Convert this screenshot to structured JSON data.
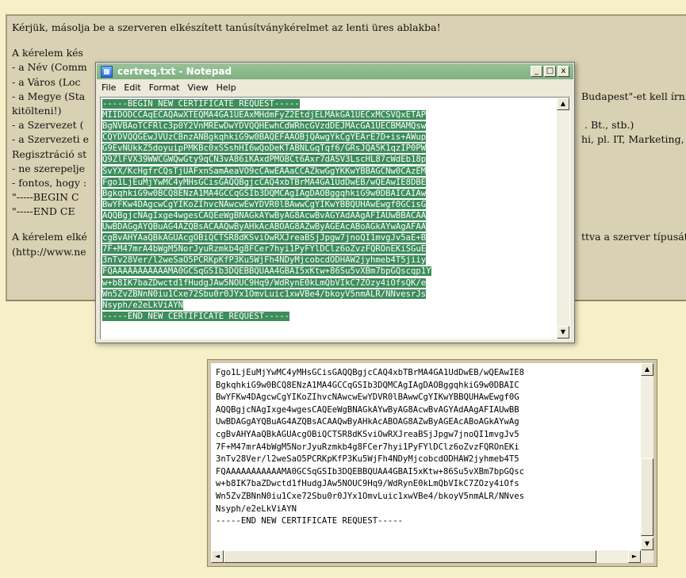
{
  "instructions": {
    "intro": "Kérjük, másolja be a szerveren elkészített tanúsítványkérelmet az lenti üres ablakba!",
    "lines": [
      "A kérelem kés",
      "- a Név (Comm",
      "- a Város (Loc",
      "- a Megye (Sta",
      "kitölteni!)",
      "- a Szervezet (",
      "- a Szervezeti e",
      "Regisztráció st",
      "- ne szerepelje",
      "- fontos, hogy :",
      "\"-----BEGIN C",
      "\"-----END CE"
    ],
    "right_fragments": [
      "",
      "",
      "",
      "Budapest\"-et kell írni!",
      "",
      ". Bt., stb.)",
      "hi, pl. IT, Marketing, H",
      "",
      "",
      "",
      "",
      ""
    ],
    "footer_lines": [
      "A kérelem elké",
      "(http://www.ne"
    ],
    "footer_right": [
      "ttva a szerver típusát",
      ""
    ]
  },
  "notepad": {
    "title": "certreq.txt - Notepad",
    "controls": {
      "minimize": "_",
      "maximize": "□",
      "close": "x"
    },
    "menu": [
      "File",
      "Edit",
      "Format",
      "View",
      "Help"
    ],
    "lines": [
      "-----BEGIN NEW CERTIFICATE REQUEST-----",
      "MIIDODCCAqECAQAwXTEQMA4GA1UEAxMHdmFyZ2EtdjELMAkGA1UECxMCSVQxETAP",
      "BgNVBAoTCFRlc3p0Y2VnMREwDwYDVQQHEwhCdWRhcGVzdDEJMAcGA1UECBMAMQsw",
      "CQYDVQQGEwJVUzCBnzANBgkqhkiG9w0BAQEFAAOBjQAwgYkCgYEArE7D+is+AWup",
      "G9EvNUkkZ5doyuipPMKBc0xSSshHI6wQoDeKTABNLGqTqf6/GRsJQA5K1qzIP0PW",
      "Q9ZlFVX39WWCGWQwGty9qCN3vA86iKAxdPMOBCt6Axr7dASV3LscHL87cWdEb18p",
      "SvYX/KcHgfrCQsTjUAFxnSamAeaVO9cCAwEAAaCCAZkwGgYKKwYBBAGCNw0CAzEM",
      "Fgo1LjEuMjYwMC4yMHsGCisGAQQBgjcCAQ4xbTBrMA4GA1UdDwEB/wQEAwIE8DBE",
      "BgkqhkiG9w0BCQ8ENzA1MA4GCCqGSIb3DQMCAgIAgDAOBggqhkiG9w0DBAICAIAw",
      "BwYFKw4DAgcwCgYIKoZIhvcNAwcwEwYDVR0lBAwwCgYIKwYBBQUHAwEwgf0GCisG",
      "AQQBgjcNAgIxge4wgesCAQEeWgBNAGkAYwByAG8AcwBvAGYAdAAgAFIAUwBBACAA",
      "UwBDAGgAYQBuAG4AZQBsACAAQwByAHkAcABOAG8AZwByAGEAcABoAGkAYwAgAFAA",
      "cgBvAHYAaQBkAGUAcgOBiQCTSR8dKSviOwRXJreaBSjJpgw7jnoQI1mvgJv5aE+B",
      "7F+M47mrA4bWgM5NorJyuRzmkb4g8FCer7hyi1PyFYlDClz6oZvzFQROnEKiSGuE",
      "3nTv28Ver/l2weSaO5PCRKpKfP3Ku5WjFh4NDyMjcobcdODHAW2jyhmeb4T5jiiy",
      "FQAAAAAAAAAAAMA0GCSqGSIb3DQEBBQUAA4GBAI5xKtw+86Su5vXBm7bpGQscqp1Y",
      "w+b8IK7baZDwctd1fHudgJAw5NOUC9Hq9/WdRynE0kLmQbVIkC7ZOzy4iOfsQK/e",
      "Wn5ZvZBNnN0iu1Cxe72Sbu0r0JYx1OmvLuic1xwVBe4/bkoyV5nmALR/NNvesrJs",
      "Nsyph/e2eLkViAYN",
      "-----END NEW CERTIFICATE REQUEST-----"
    ]
  },
  "textarea": {
    "lines": [
      "Fgo1LjEuMjYwMC4yMHsGCisGAQQBgjcCAQ4xbTBrMA4GA1UdDwEB/wQEAwIE8",
      "BgkqhkiG9w0BCQ8ENzA1MA4GCCqGSIb3DQMCAgIAgDAOBggqhkiG9w0DBAIC",
      "BwYFKw4DAgcwCgYIKoZIhvcNAwcwEwYDVR0lBAwwCgYIKwYBBQUHAwEwgf0G",
      "AQQBgjcNAgIxge4wgesCAQEeWgBNAGkAYwByAG8AcwBvAGYAdAAgAFIAUwBB",
      "UwBDAGgAYQBuAG4AZQBsACAAQwByAHkAcABOAG8AZwByAGEAcABoAGkAYwAg",
      "cgBvAHYAaQBkAGUAcgOBiQCTSR8dKSviOwRXJreaBSjJpgw7jnoQI1mvgJv5",
      "7F+M47mrA4bWgM5NorJyuRzmkb4g8FCer7hyi1PyFYlDClz6oZvzFQROnEKi",
      "3nTv28Ver/l2weSaO5PCRKpKfP3Ku5WjFh4NDyMjcobcdODHAW2jyhmeb4T5",
      "FQAAAAAAAAAAAMA0GCSqGSIb3DQEBBQUAA4GBAI5xKtw+86Su5vXBm7bpGQsc",
      "w+b8IK7baZDwctd1fHudgJAw5NOUC9Hq9/WdRynE0kLmQbVIkC7ZOzy4iOfs",
      "Wn5ZvZBNnN0iu1Cxe72Sbu0r0JYx1OmvLuic1xwVBe4/bkoyV5nmALR/NNves",
      "Nsyph/e2eLkViAYN",
      "-----END NEW CERTIFICATE REQUEST-----"
    ]
  },
  "scroll_glyphs": {
    "up": "▲",
    "down": "▼",
    "left": "◄",
    "right": "►"
  }
}
